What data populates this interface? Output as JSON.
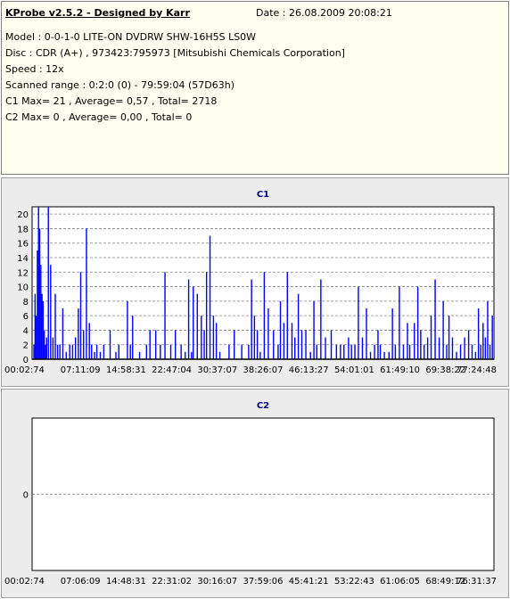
{
  "info": {
    "app_title": "KProbe v2.5.2 - Designed by Karr",
    "date_label": "Date : 26.08.2009 20:08:21",
    "lines": [
      "Model : 0-0-1-0 LITE-ON DVDRW SHW-16H5S  LS0W",
      "Disc : CDR (A+) , 973423:795973 [Mitsubishi Chemicals Corporation]",
      "Speed : 12x",
      "Scanned range : 0:2:0 (0) - 79:59:04 (57D63h)",
      "C1 Max= 21 , Average= 0,57 , Total= 2718",
      "C2 Max= 0 , Average= 0,00 , Total= 0"
    ]
  },
  "colors": {
    "bar": "#0000ff",
    "title": "#000080",
    "plot_bg": "#ffffff",
    "panel_bg": "#ececec",
    "grid": "#808080"
  },
  "chart_data": [
    {
      "type": "bar",
      "title": "C1",
      "ylim": [
        0,
        21
      ],
      "ytick_values": [
        0,
        2,
        4,
        6,
        8,
        10,
        12,
        14,
        16,
        18,
        20
      ],
      "ytick_labels": [
        "0",
        "2",
        "4",
        "6",
        "8",
        "10",
        "12",
        "14",
        "16",
        "18",
        "20"
      ],
      "xtick_labels": [
        "00:02:74",
        "07:11:09",
        "14:58:31",
        "22:47:04",
        "30:37:07",
        "38:26:07",
        "46:13:27",
        "54:01:01",
        "61:49:10",
        "69:38:22",
        "77:24:48"
      ],
      "xlim_minutes": [
        0,
        80
      ],
      "grid": true,
      "series": [
        {
          "x": [
            0.3,
            0.5,
            0.7,
            0.9,
            1.1,
            1.3,
            1.5,
            1.7,
            1.9,
            2.1,
            2.3,
            2.5,
            2.8,
            3.2,
            3.6,
            4.0,
            4.4,
            4.8,
            5.3,
            5.9,
            6.5,
            7.0,
            7.5,
            8.0,
            8.4,
            8.9,
            9.4,
            9.9,
            10.3,
            10.8,
            11.2,
            11.8,
            12.4,
            13.5,
            14.5,
            15.0,
            16.5,
            17.0,
            17.4,
            18.6,
            19.8,
            20.4,
            21.4,
            22.2,
            23.0,
            24.0,
            24.8,
            25.8,
            26.5,
            27.1,
            27.6,
            27.9,
            28.6,
            29.3,
            29.8,
            30.2,
            30.8,
            31.4,
            31.9,
            32.5,
            34.1,
            35.0,
            36.3,
            37.5,
            38.0,
            38.5,
            39.0,
            39.5,
            40.2,
            40.9,
            41.8,
            42.6,
            43.0,
            43.6,
            44.2,
            45.0,
            45.5,
            46.1,
            46.7,
            47.4,
            48.2,
            48.8,
            49.3,
            50.0,
            50.8,
            51.8,
            52.7,
            53.4,
            54.0,
            54.8,
            55.3,
            55.9,
            56.5,
            57.2,
            57.9,
            58.6,
            59.3,
            59.9,
            60.3,
            61.0,
            61.8,
            62.4,
            62.9,
            63.6,
            64.3,
            65.0,
            65.4,
            66.2,
            66.8,
            67.3,
            67.9,
            68.5,
            69.1,
            69.8,
            70.5,
            71.2,
            71.8,
            72.2,
            72.8,
            73.5,
            74.2,
            74.9,
            75.6,
            76.2,
            76.8,
            77.3,
            77.7,
            78.1,
            78.5,
            78.9,
            79.3,
            79.7
          ],
          "values": [
            2,
            9,
            6,
            15,
            21,
            18,
            13,
            9,
            8,
            4,
            2,
            3,
            21,
            13,
            3,
            9,
            2,
            2,
            7,
            1,
            2,
            2,
            3,
            7,
            12,
            4,
            18,
            5,
            2,
            1,
            2,
            1,
            2,
            4,
            1,
            2,
            8,
            2,
            6,
            1,
            2,
            4,
            4,
            2,
            12,
            2,
            4,
            2,
            1,
            11,
            1,
            10,
            9,
            6,
            4,
            12,
            17,
            6,
            5,
            1,
            2,
            4,
            2,
            2,
            11,
            6,
            4,
            1,
            12,
            7,
            4,
            2,
            8,
            5,
            12,
            5,
            3,
            9,
            4,
            4,
            1,
            8,
            2,
            11,
            3,
            4,
            2,
            2,
            2,
            3,
            2,
            2,
            10,
            3,
            7,
            1,
            2,
            4,
            2,
            1,
            1,
            7,
            2,
            10,
            2,
            5,
            2,
            5,
            10,
            4,
            2,
            3,
            6,
            11,
            3,
            8,
            2,
            6,
            3,
            1,
            2,
            3,
            4,
            2,
            1,
            7,
            2,
            5,
            3,
            8,
            2,
            6
          ]
        }
      ]
    },
    {
      "type": "bar",
      "title": "C2",
      "ylim": [
        -1,
        1
      ],
      "ytick_values": [
        0
      ],
      "ytick_labels": [
        "0"
      ],
      "xtick_labels": [
        "00:02:74",
        "07:06:09",
        "14:48:31",
        "22:31:02",
        "30:16:07",
        "37:59:06",
        "45:41:21",
        "53:22:43",
        "61:06:05",
        "68:49:12",
        "76:31:37"
      ],
      "xlim_minutes": [
        0,
        80
      ],
      "grid": true,
      "series": [
        {
          "x": [],
          "values": []
        }
      ]
    }
  ]
}
